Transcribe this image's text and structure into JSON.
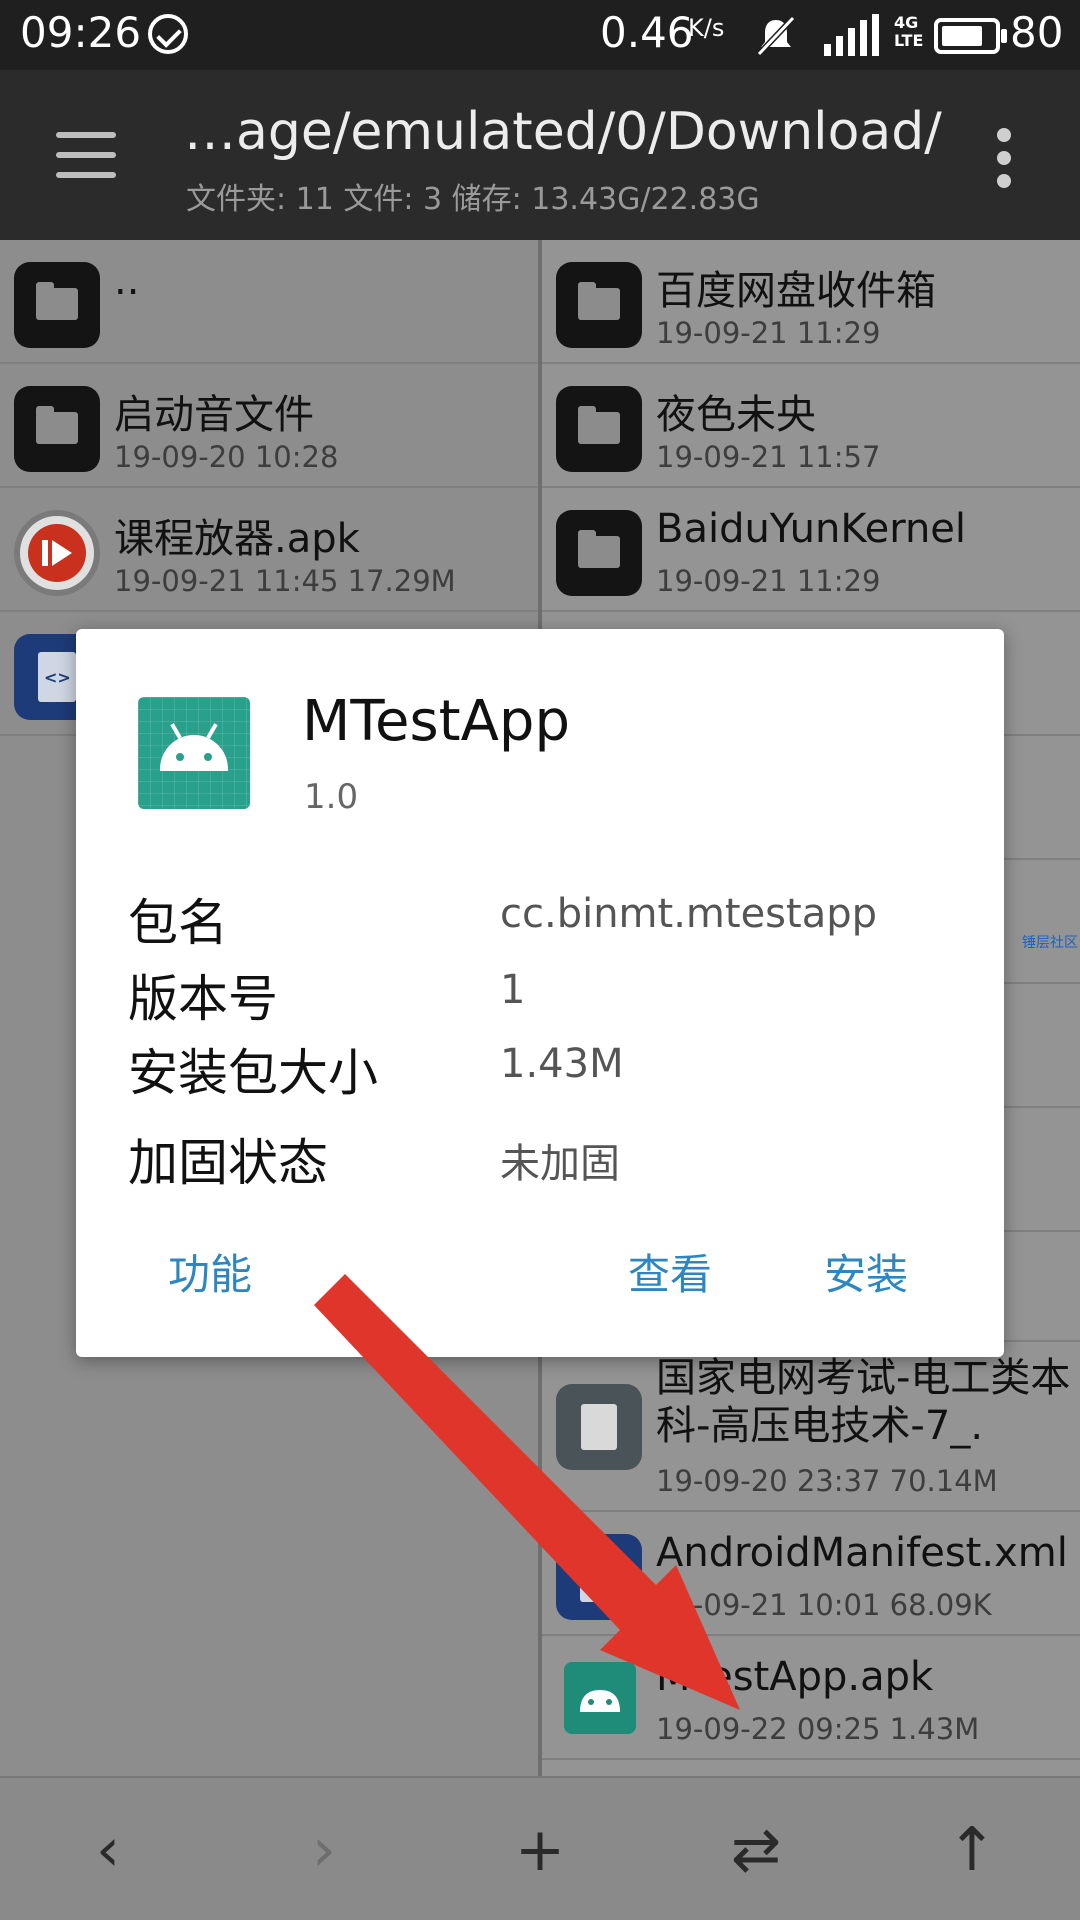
{
  "status_bar": {
    "time": "09:26",
    "net_speed": "0.46",
    "net_speed_unit": "K/s",
    "network_type": "4G",
    "network_sub": "LTE",
    "battery_level": 80,
    "battery_text": "80"
  },
  "app_bar": {
    "path": "…age/emulated/0/Download/",
    "summary": "文件夹: 11  文件: 3  储存: 13.43G/22.83G"
  },
  "left_pane": {
    "items": [
      {
        "name": "..",
        "meta": "",
        "icon": "folder-icon"
      },
      {
        "name": "启动音文件",
        "meta": "19-09-20 10:28",
        "icon": "folder-icon"
      },
      {
        "name": "课程放器.apk",
        "meta": "19-09-21 11:45  17.29M",
        "icon": "apk-icon"
      },
      {
        "name": "",
        "meta": "",
        "icon": "xml-file-icon"
      }
    ]
  },
  "right_pane": {
    "items": [
      {
        "name": "百度网盘收件箱",
        "meta": "19-09-21 11:29",
        "icon": "folder-icon"
      },
      {
        "name": "夜色未央",
        "meta": "19-09-21 11:57",
        "icon": "folder-icon"
      },
      {
        "name": "BaiduYunKernel",
        "meta": "19-09-21 11:29",
        "icon": "folder-icon"
      },
      {
        "name": "国家电网考试-电工类本科-高压电技术-7_.",
        "meta": "19-09-20 23:37  70.14M",
        "icon": "file-icon"
      },
      {
        "name": "AndroidManifest.xml",
        "meta": "19-09-21 10:01  68.09K",
        "icon": "xml-file-icon"
      },
      {
        "name": "MTestApp.apk",
        "meta": "19-09-22 09:25  1.43M",
        "icon": "android-icon"
      }
    ],
    "side_text": "锤层社区"
  },
  "dialog": {
    "app_name": "MTestApp",
    "version": "1.0",
    "rows": [
      {
        "label": "包名",
        "value": "cc.binmt.mtestapp"
      },
      {
        "label": "版本号",
        "value": "1"
      },
      {
        "label": "安装包大小",
        "value": "1.43M"
      },
      {
        "label": "加固状态",
        "value": "未加固"
      }
    ],
    "buttons": {
      "functions": "功能",
      "view": "查看",
      "install": "安装"
    }
  },
  "bottom_bar": {
    "back": "‹",
    "forward": "›",
    "add": "+",
    "swap": "⇄",
    "up": "↑"
  },
  "colors": {
    "accent_button": "#2e86c1",
    "app_icon": "#28a08b",
    "arrow": "#e0352b"
  }
}
